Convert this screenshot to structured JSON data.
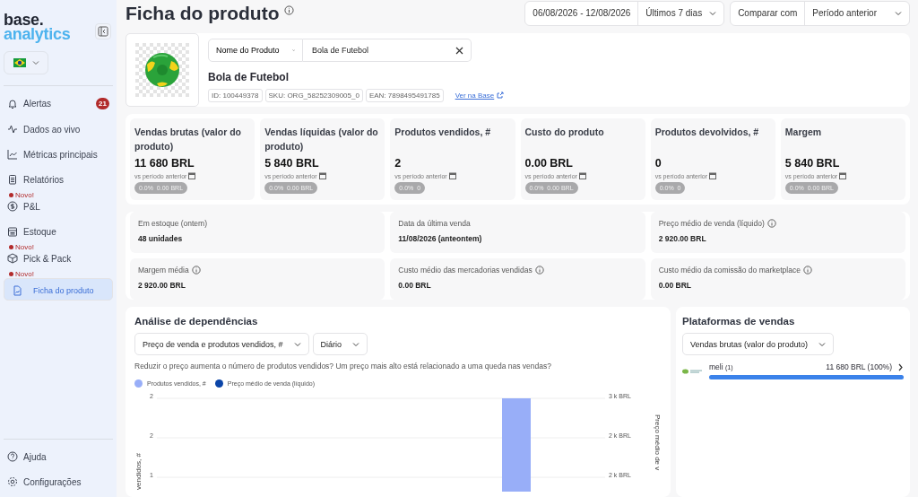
{
  "logo": {
    "line1": "base.",
    "line2": "analytics"
  },
  "sidebar": {
    "items": [
      {
        "label": "Alertas",
        "selected": false,
        "badge": "21"
      },
      {
        "label": "Dados ao vivo",
        "selected": false
      },
      {
        "label": "Métricas principais",
        "selected": false
      },
      {
        "label": "Relatórios",
        "selected": false
      },
      {
        "label": "P&L",
        "selected": false,
        "new_tag": "Novo!"
      },
      {
        "label": "Estoque",
        "selected": false
      },
      {
        "label": "Pick & Pack",
        "selected": false,
        "new_tag": "Novo!"
      },
      {
        "label": "Ficha do produto",
        "selected": true,
        "new_tag": "Novo!"
      }
    ],
    "footer_items": [
      {
        "label": "Ajuda"
      },
      {
        "label": "Configurações"
      }
    ]
  },
  "page": {
    "title": "Ficha do produto"
  },
  "period": {
    "range": "06/08/2026 - 12/08/2026",
    "preset": "Últimos 7 dias",
    "compare_label": "Comparar com",
    "compare_value": "Período anterior"
  },
  "product": {
    "search_field": "Nome do Produto",
    "search_value": "Bola de Futebol",
    "name": "Bola de Futebol",
    "tags": [
      "ID: 100449378",
      "SKU: ORG_58252309005_0",
      "EAN: 7898495491785"
    ],
    "link": "Ver na Base"
  },
  "kpis": [
    {
      "title": "Vendas brutas (valor do produto)",
      "value": "11 680 BRL",
      "compare": "vs período anterior",
      "pct": "0.0%",
      "delta": "0.00 BRL"
    },
    {
      "title": "Vendas líquidas (valor do produto)",
      "value": "5 840 BRL",
      "compare": "vs período anterior",
      "pct": "0.0%",
      "delta": "0.00 BRL"
    },
    {
      "title": "Produtos vendidos, #",
      "value": "2",
      "compare": "vs período anterior",
      "pct": "0.0%",
      "delta": "0"
    },
    {
      "title": "Custo do produto",
      "value": "0.00 BRL",
      "compare": "vs período anterior",
      "pct": "0.0%",
      "delta": "0.00 BRL"
    },
    {
      "title": "Produtos devolvidos, #",
      "value": "0",
      "compare": "vs período anterior",
      "pct": "0.0%",
      "delta": "0"
    },
    {
      "title": "Margem",
      "value": "5 840 BRL",
      "compare": "vs período anterior",
      "pct": "0.0%",
      "delta": "0.00 BRL"
    }
  ],
  "info_cards": [
    {
      "label": "Em estoque (ontem)",
      "info": false,
      "value": "48 unidades"
    },
    {
      "label": "Data da última venda",
      "info": false,
      "value": "11/08/2026 (anteontem)"
    },
    {
      "label": "Preço médio de venda (líquido)",
      "info": true,
      "value": "2 920.00 BRL"
    },
    {
      "label": "Margem média",
      "info": true,
      "value": "2 920.00 BRL"
    },
    {
      "label": "Custo médio das mercadorias vendidas",
      "info": true,
      "value": "0.00 BRL"
    },
    {
      "label": "Custo médio da comissão do marketplace",
      "info": true,
      "value": "0.00 BRL"
    }
  ],
  "dependency_analysis": {
    "title": "Análise de dependências",
    "metric_select": "Preço de venda e produtos vendidos, #",
    "interval_select": "Diário",
    "description": "Reduzir o preço aumenta o número de produtos vendidos? Um preço mais alto está relacionado a uma queda nas vendas?",
    "legend": [
      {
        "name": "Produtos vendidos, #",
        "color": "#98aef8"
      },
      {
        "name": "Preço médio de venda (líquido)",
        "color": "#0b45a8"
      }
    ],
    "left_axis": {
      "label": "vendidos, #",
      "ticks": [
        "2",
        "2",
        "1"
      ]
    },
    "right_axis": {
      "label": "Preço médio de v",
      "ticks": [
        "3 k BRL",
        "2 k BRL",
        "2 k BRL"
      ]
    }
  },
  "platforms": {
    "title": "Plataformas de vendas",
    "select": "Vendas brutas (valor do produto)",
    "rows": [
      {
        "name": "meli",
        "count": "(1)",
        "value": "11 680 BRL (100%)",
        "level": 1
      }
    ]
  }
}
